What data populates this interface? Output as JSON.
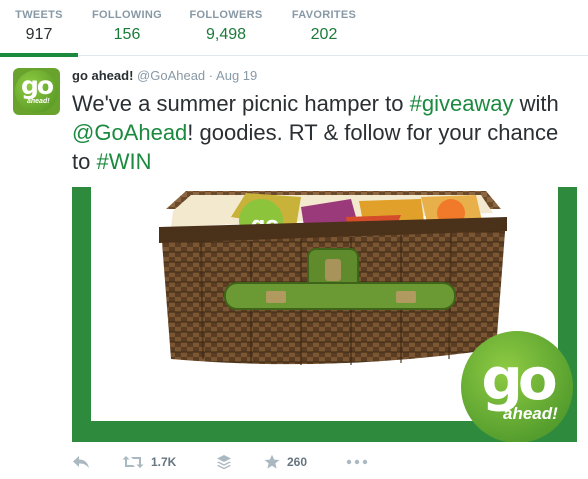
{
  "profile_stats": {
    "tweets": {
      "label": "TWEETS",
      "value": "917"
    },
    "following": {
      "label": "FOLLOWING",
      "value": "156"
    },
    "followers": {
      "label": "FOLLOWERS",
      "value": "9,498"
    },
    "favorites": {
      "label": "FAVORITES",
      "value": "202"
    },
    "active_tab": "tweets"
  },
  "tweet": {
    "fullname": "go ahead!",
    "username": "@GoAhead",
    "date": "Aug 19",
    "separator": "·",
    "avatar_text": {
      "go": "go",
      "ahead": "ahead!"
    },
    "text_parts": [
      {
        "t": "We've a summer picnic hamper to ",
        "hl": false
      },
      {
        "t": "#giveaway",
        "hl": true
      },
      {
        "t": " with ",
        "hl": false
      },
      {
        "t": "@GoAhead",
        "hl": true
      },
      {
        "t": "! goodies. RT & follow for your chance to ",
        "hl": false
      },
      {
        "t": "#WIN",
        "hl": true
      }
    ],
    "media_logo": {
      "go": "go",
      "ahead": "ahead!"
    },
    "actions": {
      "retweet_count": "1.7K",
      "favorite_count": "260"
    }
  },
  "colors": {
    "brand_green": "#1b8a3f",
    "media_frame": "#2e8b3e",
    "muted": "#8899a6"
  },
  "icons": [
    "reply-icon",
    "retweet-icon",
    "stack-icon",
    "star-icon",
    "more-icon"
  ]
}
